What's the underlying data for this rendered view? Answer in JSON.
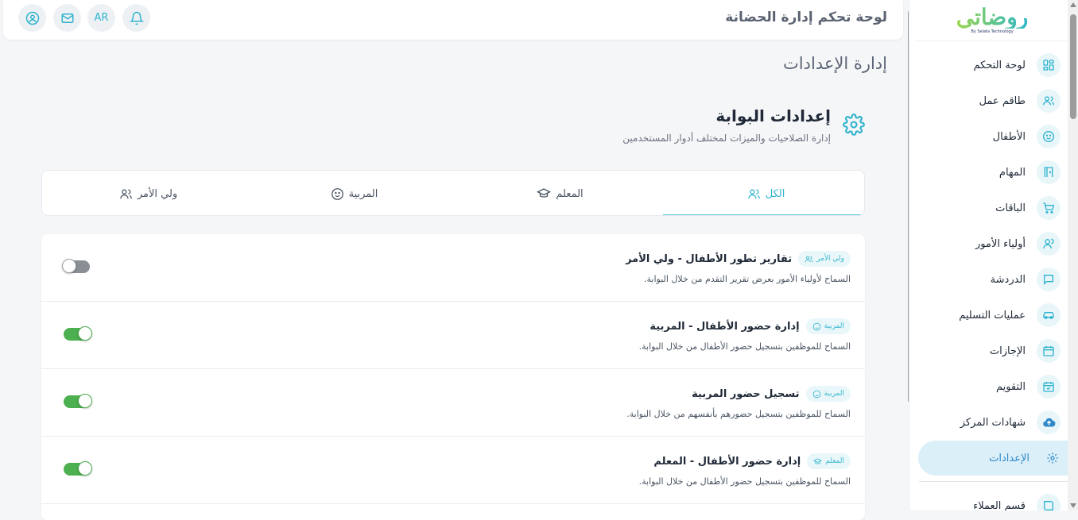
{
  "app_title": "لوحة تحكم إدارة الحضانة",
  "header": {
    "language": "AR"
  },
  "page_title": "إدارة الإعدادات",
  "logo": {
    "word": "روضاتي",
    "sub": "By Selata Technology"
  },
  "sidebar": {
    "items": [
      {
        "label": "لوحة التحكم",
        "icon": "dashboard-icon"
      },
      {
        "label": "طاقم عمل",
        "icon": "users-icon"
      },
      {
        "label": "الأطفال",
        "icon": "smile-icon"
      },
      {
        "label": "المهام",
        "icon": "door-icon"
      },
      {
        "label": "الباقات",
        "icon": "cart-icon"
      },
      {
        "label": "أولياء الأمور",
        "icon": "user-group-icon"
      },
      {
        "label": "الدردشة",
        "icon": "chat-icon"
      },
      {
        "label": "عمليات التسليم",
        "icon": "car-icon"
      },
      {
        "label": "الإجازات",
        "icon": "calendar-icon"
      },
      {
        "label": "التقويم",
        "icon": "calendar-check-icon"
      },
      {
        "label": "شهادات المركز",
        "icon": "cloud-upload-icon"
      },
      {
        "label": "الإعدادات",
        "icon": "gear-icon",
        "active": true
      },
      {
        "label": "قسم العملاء",
        "icon": "book-icon"
      }
    ]
  },
  "settings": {
    "title": "إعدادات البوابة",
    "subtitle": "إدارة الصلاحيات والميزات لمختلف أدوار المستخدمين"
  },
  "tabs": [
    {
      "label": "الكل",
      "active": true
    },
    {
      "label": "المعلم"
    },
    {
      "label": "المربية"
    },
    {
      "label": "ولي الأمر"
    }
  ],
  "rows": [
    {
      "title": "تقارير تطور الأطفال - ولي الأمر",
      "badge": "ولي الأمر",
      "desc": "السماح لأولياء الأمور بعرض تقرير التقدم من خلال البوابة.",
      "enabled": false
    },
    {
      "title": "إدارة حضور الأطفال - المربية",
      "badge": "المربية",
      "desc": "السماح للموظفين بتسجيل حضور الأطفال من خلال البوابة.",
      "enabled": true
    },
    {
      "title": "تسجيل حضور المربية",
      "badge": "المربية",
      "desc": "السماح للموظفين بتسجيل حضورهم بأنفسهم من خلال البوابة.",
      "enabled": true
    },
    {
      "title": "إدارة حضور الأطفال - المعلم",
      "badge": "المعلم",
      "desc": "السماح للموظفين بتسجيل حضور الأطفال من خلال البوابة.",
      "enabled": true
    }
  ],
  "colors": {
    "accent": "#2fb3cf",
    "toggle_on": "#4caf50",
    "toggle_off": "#8a8f96",
    "active_bg": "#daeff8"
  }
}
